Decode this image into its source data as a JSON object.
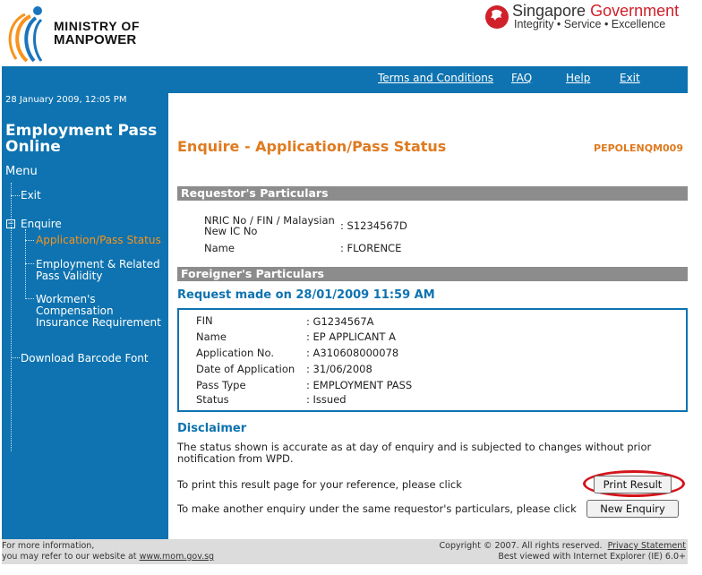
{
  "header": {
    "ministry_line1": "MINISTRY OF",
    "ministry_line2": "MANPOWER",
    "sg_title_part1": "Singapore",
    "sg_title_part2": "Government",
    "sg_tagline": "Integrity • Service • Excellence"
  },
  "topnav": {
    "terms": "Terms and Conditions",
    "faq": "FAQ",
    "help": "Help",
    "exit": "Exit"
  },
  "sidebar": {
    "timestamp": "28 January 2009, 12:05 PM",
    "app_title": "Employment Pass Online",
    "menu_label": "Menu",
    "exit": "Exit",
    "enquire": "Enquire",
    "expander": "−",
    "sub_items": [
      "Application/Pass Status",
      "Employment & Related Pass Validity",
      "Workmen's Compensation Insurance Requirement"
    ],
    "download": "Download Barcode Font"
  },
  "main": {
    "title": "Enquire - Application/Pass Status",
    "code": "PEPOLENQM009",
    "requestor_section": "Requestor's Particulars",
    "requestor_fields": [
      {
        "label": "NRIC No / FIN / Malaysian New IC No",
        "value": ": S1234567D"
      },
      {
        "label": "Name",
        "value": ": FLORENCE"
      }
    ],
    "foreigner_section": "Foreigner's Particulars",
    "request_made": "Request made on  28/01/2009 11:59 AM",
    "foreigner_fields": [
      {
        "label": "FIN",
        "value": ": G1234567A"
      },
      {
        "label": "Name",
        "value": ": EP APPLICANT A"
      },
      {
        "label": "Application No.",
        "value": ": A310608000078"
      },
      {
        "label": "Date of Application",
        "value": ": 31/06/2008"
      },
      {
        "label": "Pass Type",
        "value": ": EMPLOYMENT PASS"
      },
      {
        "label": "Status",
        "value": ": Issued"
      }
    ],
    "disclaimer_title": "Disclaimer",
    "disclaimer_text": "The status shown is accurate as at day of enquiry and is subjected to changes without prior notification from WPD.",
    "print_text": "To print this result page for your reference, please click",
    "print_button": "Print Result",
    "new_text": "To make another enquiry under the same requestor's particulars, please click",
    "new_button": "New Enquiry"
  },
  "footer": {
    "info_line1": "For more information,",
    "info_line2_prefix": "you may refer to our website at ",
    "website": "www.mom.gov.sg",
    "copyright": "Copyright © 2007. All rights reserved.",
    "privacy": "Privacy Statement",
    "best_viewed": "Best viewed with Internet Explorer (IE) 6.0+"
  },
  "colors": {
    "nav_blue": "#0e73b0",
    "accent_orange": "#e07a1f",
    "section_gray": "#8c8c8c",
    "highlight_red": "#d4141c"
  }
}
